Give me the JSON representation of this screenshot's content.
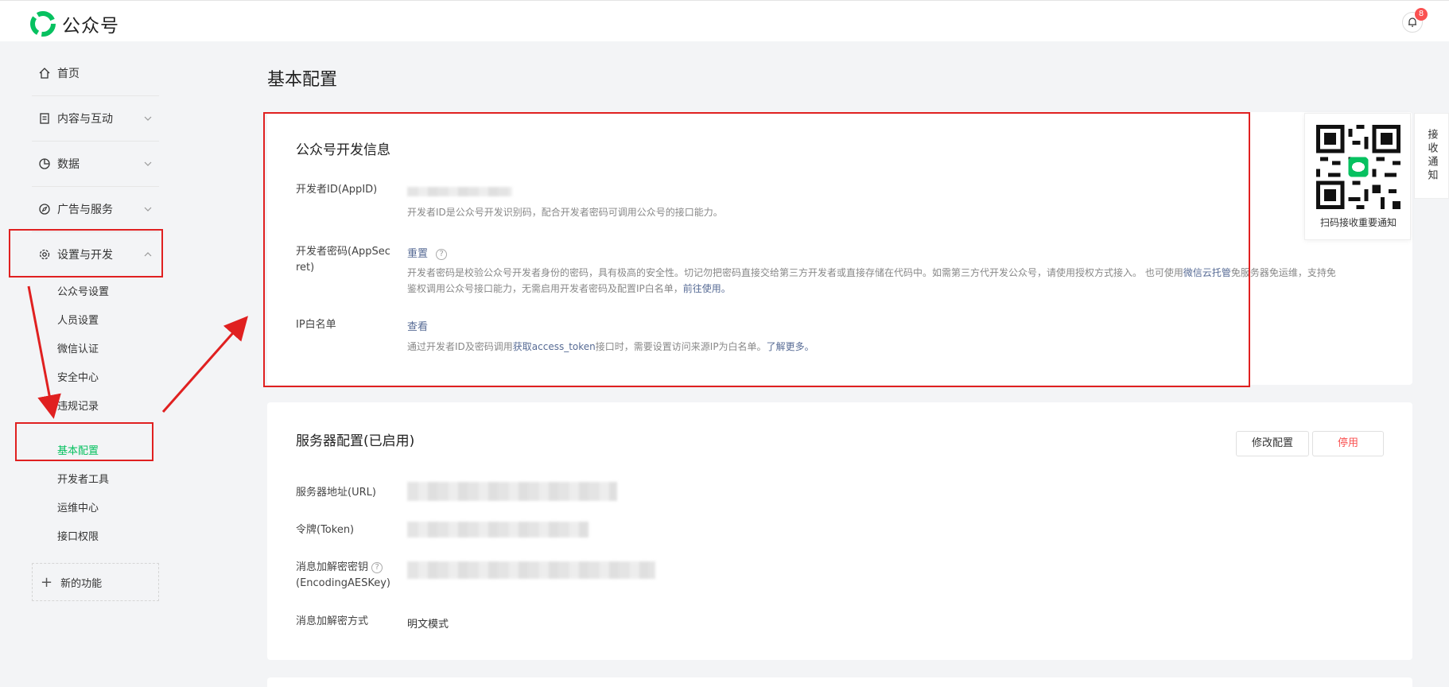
{
  "app": {
    "title": "公众号",
    "notification_count": "8"
  },
  "sidebar": {
    "home": "首页",
    "content": "内容与互动",
    "data": "数据",
    "ads": "广告与服务",
    "settings": "设置与开发",
    "sub_items": [
      "公众号设置",
      "人员设置",
      "微信认证",
      "安全中心",
      "违规记录",
      "基本配置",
      "开发者工具",
      "运维中心",
      "接口权限"
    ],
    "new_feature": "新的功能"
  },
  "page": {
    "title": "基本配置"
  },
  "dev_info": {
    "title": "公众号开发信息",
    "appid_label": "开发者ID(AppID)",
    "appid_desc": "开发者ID是公众号开发识别码，配合开发者密码可调用公众号的接口能力。",
    "secret_label_1": "开发者密码(AppSec",
    "secret_label_2": "ret)",
    "secret_action": "重置",
    "secret_desc_1": "开发者密码是校验公众号开发者身份的密码，具有极高的安全性。切记勿把密码直接交给第三方开发者或直接存储在代码中。如需第三方代开发公众号，请使用授权方式接入。 也可使用",
    "secret_desc_link1": "微信云托管",
    "secret_desc_2": "免服务器免运维，支持免",
    "secret_desc_3": "鉴权调用公众号接口能力，无需启用开发者密码及配置IP白名单，",
    "secret_desc_link2": "前往使用。",
    "ip_label": "IP白名单",
    "ip_action": "查看",
    "ip_desc_1": "通过开发者ID及密码调用",
    "ip_desc_link1": "获取access_token",
    "ip_desc_2": "接口时，需要设置访问来源IP为白名单。",
    "ip_desc_link2": "了解更多。"
  },
  "server_config": {
    "title": "服务器配置(已启用)",
    "modify_button": "修改配置",
    "disable_button": "停用",
    "url_label": "服务器地址(URL)",
    "token_label": "令牌(Token)",
    "aeskey_label_1": "消息加解密密钥",
    "aeskey_label_2": "(EncodingAESKey)",
    "mode_label": "消息加解密方式",
    "mode_value": "明文模式"
  },
  "qr_panel": {
    "caption": "扫码接收重要通知",
    "side_tab": "接收通知"
  },
  "colors": {
    "accent": "#07c160",
    "link": "#576b95",
    "danger": "#fa5151",
    "annotation": "#e02020"
  }
}
